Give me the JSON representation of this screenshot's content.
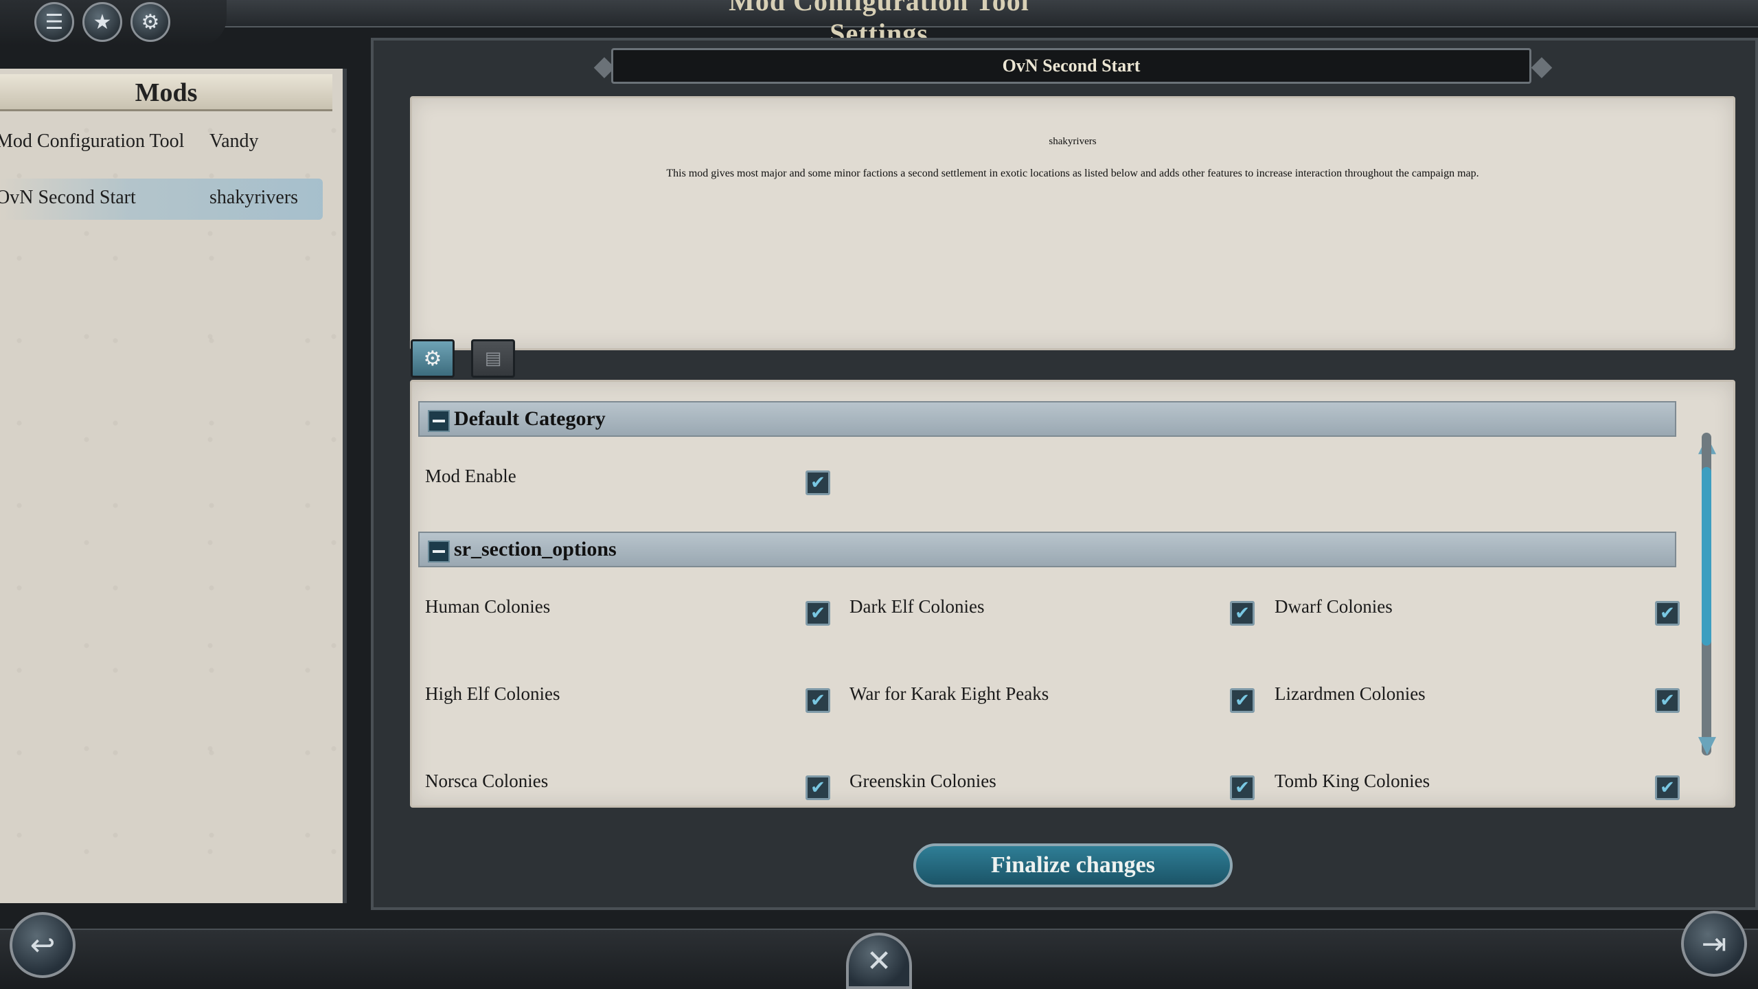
{
  "window": {
    "title": "Mod Configuration Tool Settings"
  },
  "top_bar": {
    "icons": [
      {
        "name": "chat-icon",
        "glyph": "☰"
      },
      {
        "name": "star-icon",
        "glyph": "★"
      },
      {
        "name": "gears-icon",
        "glyph": "⚙"
      }
    ]
  },
  "mods_panel": {
    "header": "Mods",
    "mods": [
      {
        "name": "Mod Configuration Tool",
        "author": "Vandy",
        "selected": false
      },
      {
        "name": "OvN Second Start",
        "author": "shakyrivers",
        "selected": true
      }
    ]
  },
  "detail": {
    "title": "OvN Second Start",
    "author": "shakyrivers",
    "description": "This mod gives most major and some minor factions a second settlement in exotic locations as listed below and adds other features to increase interaction throughout the campaign map."
  },
  "tabs": [
    {
      "name": "settings-tab",
      "icon": "gears-icon",
      "glyph": "⚙",
      "active": true
    },
    {
      "name": "info-tab",
      "icon": "document-icon",
      "glyph": "▤",
      "active": false
    }
  ],
  "sections": {
    "default": {
      "label": "Default Category",
      "options": [
        {
          "label": "Mod Enable",
          "checked": true
        }
      ]
    },
    "sr": {
      "label": "sr_section_options",
      "options": [
        {
          "label": "Human Colonies",
          "checked": true
        },
        {
          "label": "Dark Elf Colonies",
          "checked": true
        },
        {
          "label": "Dwarf Colonies",
          "checked": true
        },
        {
          "label": "High Elf Colonies",
          "checked": true
        },
        {
          "label": "War for Karak Eight Peaks",
          "checked": true
        },
        {
          "label": "Lizardmen Colonies",
          "checked": true
        },
        {
          "label": "Norsca Colonies",
          "checked": true
        },
        {
          "label": "Greenskin Colonies",
          "checked": true
        },
        {
          "label": "Tomb King Colonies",
          "checked": true
        }
      ]
    }
  },
  "check_glyph": "✔",
  "finalize_label": "Finalize changes",
  "bottom_bar": {
    "back_icon": "back-arrow-icon",
    "back_glyph": "↩",
    "close_icon": "crossed-swords-icon",
    "close_glyph": "✕",
    "exit_icon": "exit-door-icon",
    "exit_glyph": "⇥"
  },
  "colors": {
    "accent": "#3d9ec0",
    "checkbox_fill": "#2a3e49",
    "parchment": "#dfdad1",
    "frame": "#2d3236"
  }
}
